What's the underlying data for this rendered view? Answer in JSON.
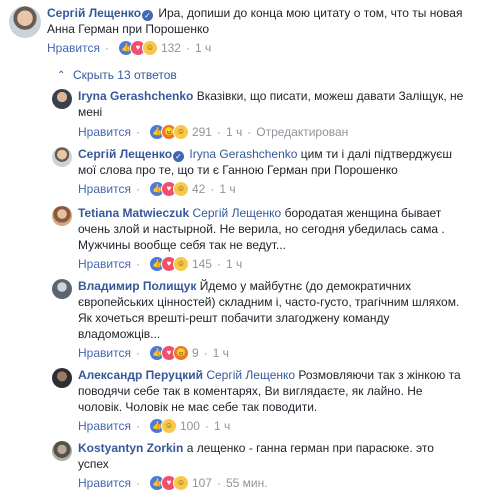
{
  "main_comment": {
    "author": "Сергій Лещенко",
    "text_line1": "Ира, допиши до конца мою цитату о том, что ты новая",
    "text_line2": "Анна Герман при Порошенко",
    "like_label": "Нравится",
    "reaction_count": "132",
    "time": "1 ч",
    "reactions": [
      "like-icon",
      "love-icon",
      "haha-icon"
    ]
  },
  "replies_toggle": {
    "label": "Скрыть 13 ответов"
  },
  "replies": [
    {
      "author": "Iryna Gerashchenko",
      "text_lines": [
        "Вказівки, що писати, можеш давати Заліщук, не",
        "мені"
      ],
      "like_label": "Нравится",
      "reaction_count": "291",
      "time": "1 ч",
      "extra": "Отредактирован"
    },
    {
      "author": "Сергій Лещенко",
      "mention": "Iryna Gerashchenko",
      "text_lines": [
        "цим ти і далі підтверджуєш",
        "мої слова про те, що ти є Ганною Герман при Порошенко"
      ],
      "like_label": "Нравится",
      "reaction_count": "42",
      "time": "1 ч"
    },
    {
      "author": "Tetiana Matwieczuk",
      "mention": "Сергій Лещенко",
      "text_lines": [
        "бородатая женщина бывает",
        "очень злой и настырной. Не верила, но сегодня убедилась сама .",
        "Мужчины вообще себя так не ведут..."
      ],
      "like_label": "Нравится",
      "reaction_count": "145",
      "time": "1 ч"
    },
    {
      "author": "Владимир Полищук",
      "text_lines": [
        "Йдемо у майбутнє (до демократичних",
        "європейських цінностей) складним і, часто-густо, трагічним шляхом.",
        "Як хочеться врешті-решт побачити злагоджену команду",
        "владоможців..."
      ],
      "like_label": "Нравится",
      "reaction_count": "9",
      "time": "1 ч"
    },
    {
      "author": "Александр Перуцкий",
      "mention": "Сергій Лещенко",
      "text_lines": [
        "Розмовляючи так з жінкою та",
        "поводячи себе так в коментарях, Ви виглядаєте, як лайно. Не",
        "чоловік. Чоловік не має себе так поводити."
      ],
      "like_label": "Нравится",
      "reaction_count": "100",
      "time": "1 ч"
    },
    {
      "author": "Kostyantyn Zorkin",
      "text_lines": [
        "а лещенко - ганна герман при парасюке. это",
        "успех"
      ],
      "like_label": "Нравится",
      "reaction_count": "107",
      "time": "55 мин."
    }
  ],
  "colors": {
    "link": "#365899",
    "meta": "#90949c",
    "like_blue": "#4267b2",
    "text": "#1d2129"
  }
}
